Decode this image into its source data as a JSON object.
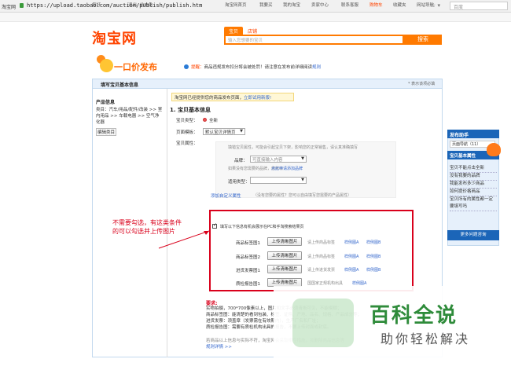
{
  "browser": {
    "site_label": "淘宝网",
    "url": "https://upload.taobao.com/auction/publish/publish.htm",
    "search_placeholder": "百度"
  },
  "topbar": {
    "greeting": "您好",
    "logout": "退出",
    "messages": "站内信",
    "links": [
      "淘宝网首页",
      "我要买",
      "我的淘宝",
      "卖家中心",
      "联系客服",
      "购物车",
      "收藏夹",
      "网站导航"
    ]
  },
  "header": {
    "logo": "淘宝网",
    "tabs": [
      "宝贝",
      "店铺"
    ],
    "search_placeholder": "输入您想要的宝贝",
    "search_button": "搜索"
  },
  "publish": {
    "title": "一口价发布",
    "notice_prefix": "提醒：",
    "notice_text": "商品违规发布扣分将会被处罚！请注意在发布前详细阅读",
    "notice_link": "规则"
  },
  "panel": {
    "title": "填写宝贝基本信息",
    "required_note": "* 表示该项必填",
    "category_title": "产品信息",
    "category_path": "类目：汽车/用品/配件/改装 >> 室内用品 >> 车载电器 >> 空气净化器",
    "category_edit": "编辑类目",
    "yellow_note": "淘宝网已经提供您的商品发布页面，",
    "yellow_link": "立即试用新版!",
    "section_title": "1. 宝贝基本信息",
    "type_label": "宝贝类型：",
    "type_value": "全新",
    "page_template_label": "页面模板：",
    "page_template_value": "默认宝贝详情页",
    "attrs_label": "宝贝属性：",
    "attrs_hint": "填错宝贝属性，可能会引起宝贝下架，影响您的正常销售，请认真准确填写",
    "brand_label": "品牌：",
    "brand_placeholder": "可直接输入内容",
    "brand_hint": "如果没有您需要的品牌，您可以",
    "brand_link": "点此申请添加品牌",
    "goods_type_label": "适用类型：",
    "add_custom": "添加自定义属性",
    "add_custom_hint": "（没有您要的属性？您可以自由填写您需要的产品属性）",
    "checkbox_label": "填写以下信息有机会展示在PC和手淘搜索结果页",
    "uploads": [
      {
        "label": "商品标签图1",
        "button": "上传清晰图片",
        "hint": "请上传商品标签",
        "link": "样例图A",
        "link2": "样例图B"
      },
      {
        "label": "商品标签图2",
        "button": "上传清晰图片",
        "hint": "请上传商品标签",
        "link": "样例图A",
        "link2": "样例图B"
      },
      {
        "label": "进货发票图1",
        "button": "上传清晰图片",
        "hint": "请上传进货发票",
        "link": "样例图A",
        "link2": "样例图B"
      },
      {
        "label": "质检报告图1",
        "button": "上传清晰图片",
        "hint": "国国家正规机构出具",
        "link": "样例图A",
        "link2": ""
      }
    ],
    "annotation": "不需要勾选，有这类条件的可以勾选并上传图片",
    "req_title": "要求:",
    "req_lines": [
      "实物拍摄，700*700像素以上，图片和文字必须清晰可见，不能模糊；",
      "商品标签图：能清楚的看到包装、标签、证件、产地、品名、规格、产品成分等；",
      "进货发票：须盖章（发票需在有效期内），生产厂名和厂址；",
      "质检报告图：需要有质检机构出具的报告，不要上传封面或封底。"
    ],
    "bottom_note": "若商品以上信息与实际不符，淘宝网会采取相应措施，如删除商品信息等",
    "bottom_link": "规则详情 >>"
  },
  "assistant": {
    "title": "发布助手",
    "select_value": "页面导航（11）",
    "active": "宝贝基本属性",
    "items": [
      "宝贝不能点击全新",
      "没有我要的品牌",
      "我能发布多少商品",
      "如何提价格商品",
      "宝贝所有的属性都一定要填写吗"
    ],
    "more": "更多问题咨询"
  },
  "watermark": {
    "title": "百科全说",
    "subtitle": "助你轻松解决"
  }
}
